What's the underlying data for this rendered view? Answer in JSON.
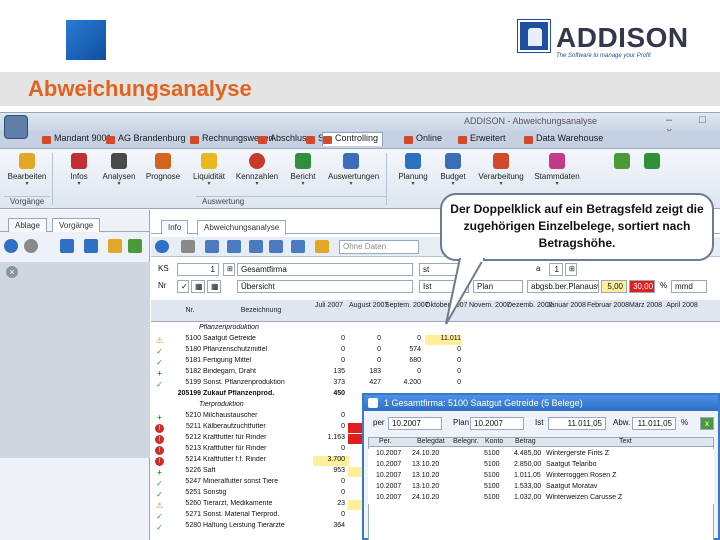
{
  "slide": {
    "title": "Abweichungsanalyse",
    "logo_text": "ADDISON",
    "logo_tagline": "The Software to manage your Profit"
  },
  "window": {
    "title": "ADDISON - Abweichungsanalyse",
    "controls": "– □ ×"
  },
  "menu": [
    {
      "label": "Mandant 9001"
    },
    {
      "label": "AG Brandenburg"
    },
    {
      "label": "Rechnungswesen"
    },
    {
      "label": "Abschluss"
    },
    {
      "label": "Steuern"
    },
    {
      "label": "Controlling"
    },
    {
      "label": "Online"
    },
    {
      "label": "Erweitert"
    },
    {
      "label": "Data Warehouse"
    }
  ],
  "ribbon": {
    "buttons": [
      {
        "label": "Bearbeiten",
        "icon": "edit-icon"
      },
      {
        "label": "Infos",
        "icon": "info-icon"
      },
      {
        "label": "Analysen",
        "icon": "traffic-light-icon"
      },
      {
        "label": "Prognose",
        "icon": "prognosis-icon"
      },
      {
        "label": "Liquidität",
        "icon": "coins-icon"
      },
      {
        "label": "Kennzahlen",
        "icon": "target-icon"
      },
      {
        "label": "Bericht",
        "icon": "report-icon"
      },
      {
        "label": "Auswertungen",
        "icon": "evaluation-icon"
      },
      {
        "label": "Planung",
        "icon": "planning-icon"
      },
      {
        "label": "Budget",
        "icon": "budget-icon"
      },
      {
        "label": "Verarbeitung",
        "icon": "processing-icon"
      },
      {
        "label": "Stammdaten",
        "icon": "master-data-icon"
      }
    ],
    "groups": [
      "Vorgänge",
      "Auswertung"
    ]
  },
  "left_panel": {
    "tabs": [
      "Ablage",
      "Vorgänge"
    ]
  },
  "main": {
    "tabs": [
      "Info",
      "Abweichungsanalyse"
    ],
    "search_placeholder": "Ohne Daten",
    "filter_row1": {
      "label": "KS",
      "num": "1",
      "name": "Gesamtfirma",
      "type": "st",
      "period_label": "a",
      "period": "1",
      "pct": "5,00",
      "pct2": "30,00",
      "unit_pct": "%",
      "unit_t": "mmd"
    },
    "filter_row2": {
      "label": "Nr",
      "name": "Übersicht",
      "basis": "Ist",
      "compare": "Plan",
      "mode": "abgsb.ber.Planauswahl"
    },
    "columns": [
      "Nr.",
      "Bezeichnung",
      "Juli 2007",
      "August 2007",
      "Septem. 2007",
      "Oktober 2007",
      "Novem. 2007",
      "Dezemb. 2007",
      "Januar 2008",
      "Februar 2008",
      "März 2008",
      "April 2008"
    ],
    "rows": [
      {
        "status": "",
        "nr": "",
        "name": "Pflanzenproduktion",
        "group": true,
        "v": [
          "",
          "",
          "",
          ""
        ]
      },
      {
        "status": "warn",
        "nr": "5100",
        "name": "Saatgut Getreide",
        "v": [
          "0",
          "0",
          "0",
          "11.011"
        ]
      },
      {
        "status": "check",
        "nr": "5180",
        "name": "Pflanzenschutzmittel",
        "v": [
          "0",
          "0",
          "574",
          "0"
        ]
      },
      {
        "status": "check",
        "nr": "5181",
        "name": "Fertigung Mittel",
        "v": [
          "0",
          "0",
          "680",
          "0"
        ]
      },
      {
        "status": "plus",
        "nr": "5182",
        "name": "Bindegarn, Draht",
        "v": [
          "135",
          "183",
          "0",
          "0"
        ]
      },
      {
        "status": "check",
        "nr": "5199",
        "name": "Sonst. Pflanzenproduktion",
        "v": [
          "373",
          "427",
          "4.200",
          "0"
        ]
      },
      {
        "status": "",
        "nr": "205199",
        "name": "Zukauf Pflanzenprod.",
        "total": true,
        "v": [
          "450",
          "",
          "",
          ""
        ]
      },
      {
        "status": "",
        "nr": "",
        "name": "Tierproduktion",
        "group": true,
        "v": [
          "",
          "",
          "",
          ""
        ]
      },
      {
        "status": "plus",
        "nr": "5210",
        "name": "Milchaustauscher",
        "v": [
          "0",
          "",
          "",
          ""
        ]
      },
      {
        "status": "bad",
        "nr": "5211",
        "name": "Kälberaufzuchtfutter",
        "v": [
          "0",
          "",
          "",
          ""
        ]
      },
      {
        "status": "bad",
        "nr": "5212",
        "name": "Kraftfutter für Rinder",
        "v": [
          "1.163",
          "",
          "",
          ""
        ]
      },
      {
        "status": "bad",
        "nr": "5213",
        "name": "Kraftfutter für Rinder",
        "v": [
          "0",
          "",
          "",
          ""
        ]
      },
      {
        "status": "bad",
        "nr": "5214",
        "name": "Kraftfutter f.f. Rinder",
        "v": [
          "3.700",
          "",
          "",
          ""
        ]
      },
      {
        "status": "plus",
        "nr": "5226",
        "name": "Saft",
        "v": [
          "953",
          "",
          "",
          ""
        ]
      },
      {
        "status": "check",
        "nr": "5247",
        "name": "Mineralfutter sonst Tiere",
        "v": [
          "0",
          "",
          "",
          ""
        ]
      },
      {
        "status": "check",
        "nr": "5251",
        "name": "Sonstig",
        "v": [
          "0",
          "",
          "",
          ""
        ]
      },
      {
        "status": "warn",
        "nr": "5260",
        "name": "Tierarzt, Medikamente",
        "v": [
          "23",
          "",
          "",
          ""
        ]
      },
      {
        "status": "check",
        "nr": "5271",
        "name": "Sonst. Material Tierprod.",
        "v": [
          "0",
          "",
          "",
          ""
        ]
      },
      {
        "status": "check",
        "nr": "5280",
        "name": "Haltung Leistung Tierarzte",
        "v": [
          "364",
          "",
          "",
          ""
        ]
      }
    ]
  },
  "callout": {
    "text": "Der Doppelklick auf ein Betragsfeld zeigt die zugehörigen Einzelbelege, sortiert nach Betragshöhe."
  },
  "popup": {
    "title": "1 Gesamtfirma: 5100 Saatgut Getreide  (5 Belege)",
    "filter": {
      "label1": "per",
      "val1": "10.2007",
      "label2": "Plan",
      "val2": "10.2007",
      "label3": "Ist",
      "val3": "11.011,05",
      "label4": "Abw.",
      "val4": "11.011,05",
      "unit": "%"
    },
    "columns": [
      "Per.",
      "Belegdat",
      "Belegnr.",
      "Konto",
      "Betrag",
      "Text"
    ],
    "rows": [
      {
        "per": "10.2007",
        "date": "24.10.20",
        "bnr": "",
        "konto": "5100",
        "betrag": "4.485,00",
        "text": "Wintergerste Firits Z"
      },
      {
        "per": "10.2007",
        "date": "13.10.20",
        "bnr": "",
        "konto": "5100",
        "betrag": "2.850,00",
        "text": "Saatgut Telaribo"
      },
      {
        "per": "10.2007",
        "date": "13.10.20",
        "bnr": "",
        "konto": "5100",
        "betrag": "1.011,05",
        "text": "Winterroggen Rosen Z"
      },
      {
        "per": "10.2007",
        "date": "13.10.20",
        "bnr": "",
        "konto": "5100",
        "betrag": "1.533,00",
        "text": "Saatgut Moratav"
      },
      {
        "per": "10.2007",
        "date": "24.10.20",
        "bnr": "",
        "konto": "5100",
        "betrag": "1.032,00",
        "text": "Winterweizen Carusse Z"
      }
    ]
  },
  "colors": {
    "accent_title": "#e0641e",
    "popup_title": "#2f6fc4",
    "highlight_yellow": "#ffef9c",
    "highlight_red": "#e01e1e"
  }
}
